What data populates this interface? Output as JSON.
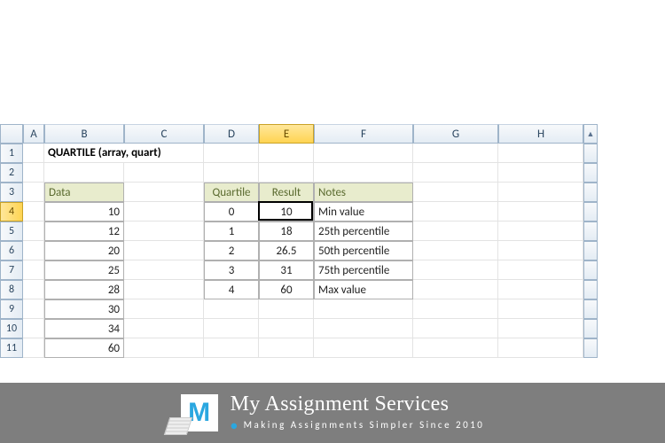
{
  "columns": [
    "A",
    "B",
    "C",
    "D",
    "E",
    "F",
    "G",
    "H"
  ],
  "active_col_index": 4,
  "rows": [
    1,
    2,
    3,
    4,
    5,
    6,
    7,
    8,
    9,
    10,
    11
  ],
  "active_row_index": 3,
  "title": "QUARTILE (array, quart)",
  "data_header": "Data",
  "data_values": [
    10,
    12,
    20,
    25,
    28,
    30,
    34,
    60
  ],
  "result_headers": {
    "quartile": "Quartile",
    "result": "Result",
    "notes": "Notes"
  },
  "result_rows": [
    {
      "q": 0,
      "r": 10,
      "n": "Min value"
    },
    {
      "q": 1,
      "r": 18,
      "n": "25th percentile"
    },
    {
      "q": 2,
      "r": 26.5,
      "n": "50th percentile"
    },
    {
      "q": 3,
      "r": 31,
      "n": "75th percentile"
    },
    {
      "q": 4,
      "r": 60,
      "n": "Max value"
    }
  ],
  "active_cell": {
    "col": "E",
    "row": 4,
    "value": 10
  },
  "brand": {
    "logo_letter": "M",
    "title": "My Assignment Services",
    "tagline": "Making Assignments Simpler Since 2010"
  },
  "colors": {
    "header_grad_top": "#f7f9fb",
    "header_grad_bot": "#e4ecf4",
    "header_border": "#9fb4c9",
    "selected_grad_top": "#ffe79b",
    "selected_grad_bot": "#ffd452",
    "label_bg": "#e8eccd",
    "footer_bg": "#7e7e7e",
    "brand_accent": "#2aa7e0"
  },
  "chart_data": {
    "type": "table",
    "title": "QUARTILE (array, quart)",
    "input_series": {
      "name": "Data",
      "values": [
        10,
        12,
        20,
        25,
        28,
        30,
        34,
        60
      ]
    },
    "output": {
      "columns": [
        "Quartile",
        "Result",
        "Notes"
      ],
      "rows": [
        [
          0,
          10,
          "Min value"
        ],
        [
          1,
          18,
          "25th percentile"
        ],
        [
          2,
          26.5,
          "50th percentile"
        ],
        [
          3,
          31,
          "75th percentile"
        ],
        [
          4,
          60,
          "Max value"
        ]
      ]
    }
  }
}
